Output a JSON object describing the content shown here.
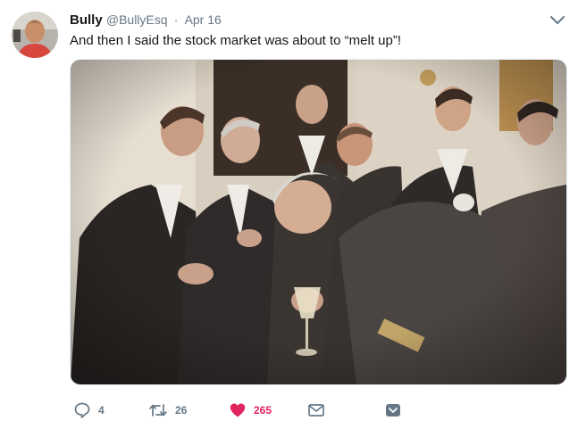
{
  "tweet": {
    "display_name": "Bully",
    "handle": "@BullyEsq",
    "separator": "·",
    "date": "Apr 16",
    "text": "And then I said the stock market was about to “melt up”!",
    "media_description": "photo"
  },
  "actions": {
    "reply_count": "4",
    "retweet_count": "26",
    "like_count": "265"
  },
  "colors": {
    "like": "#e0245e",
    "retweet": "#17bf63",
    "muted": "#657786",
    "text": "#14171a"
  },
  "icons": [
    "reply-icon",
    "retweet-icon",
    "like-heart-icon",
    "direct-message-icon",
    "more-caret-icon",
    "share-caret-icon"
  ]
}
